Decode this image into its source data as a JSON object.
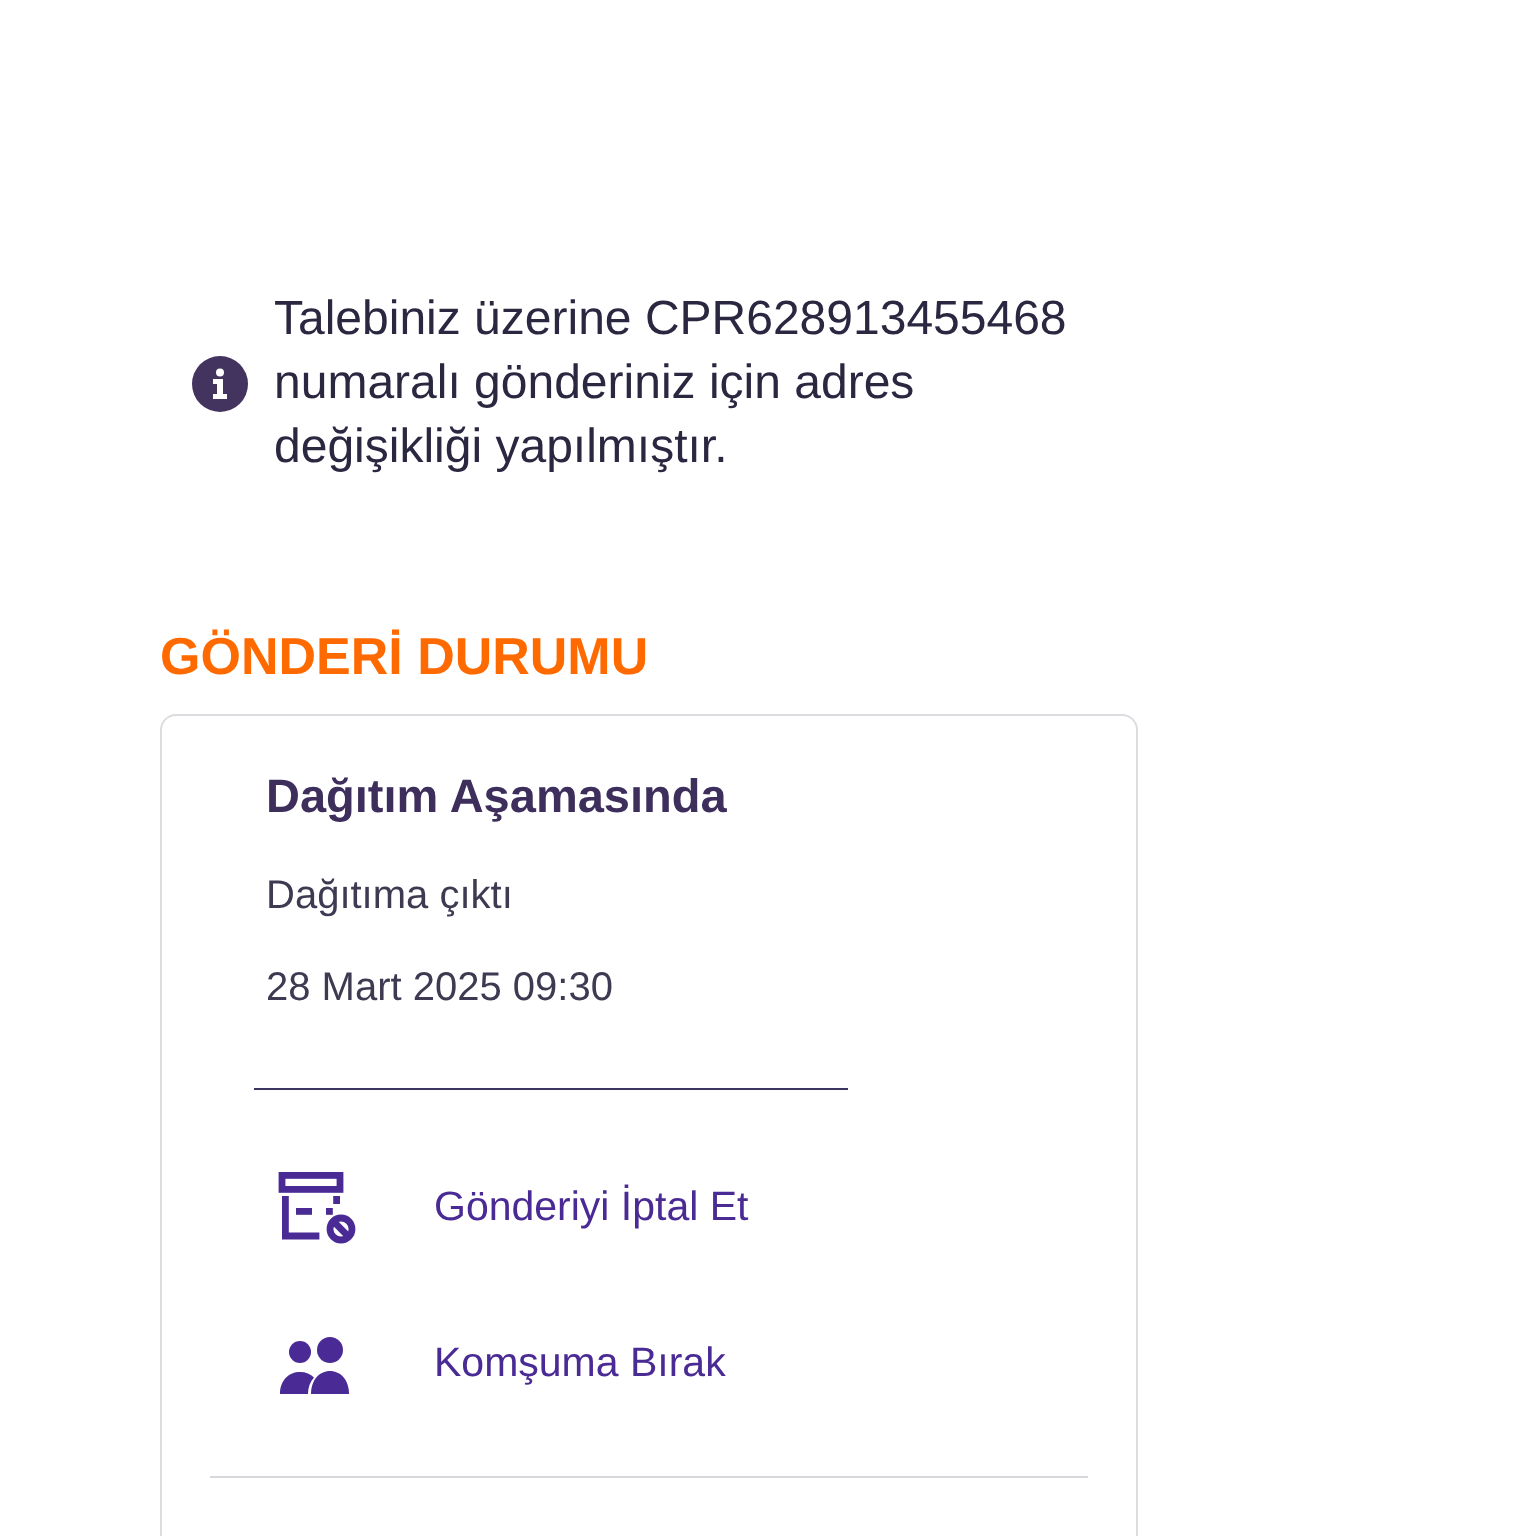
{
  "notice": {
    "text": "Talebiniz üzerine CPR628913455468 numaralı gönderiniz için adres değişikliği yapılmıştır."
  },
  "section_title": "GÖNDERİ DURUMU",
  "status_card": {
    "title": "Dağıtım Aşamasında",
    "description": "Dağıtıma çıktı",
    "date": "28 Mart 2025 09:30",
    "actions": [
      {
        "kind": "cancel",
        "label": "Gönderiyi İptal Et"
      },
      {
        "kind": "neighbor",
        "label": "Komşuma Bırak"
      }
    ]
  }
}
